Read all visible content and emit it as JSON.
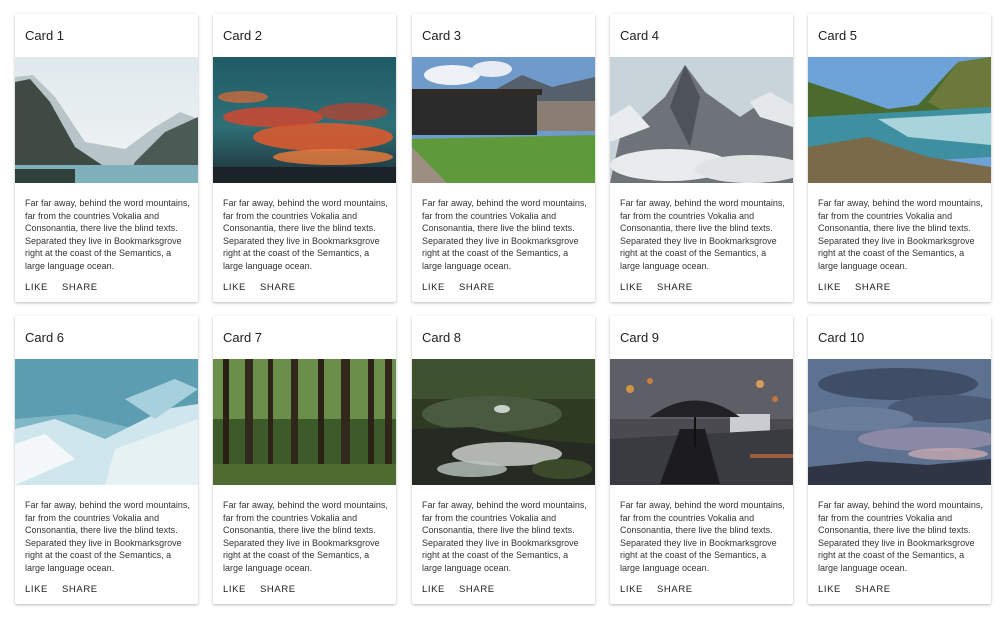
{
  "cards": [
    {
      "title": "Card 1",
      "image": "mountain-lake",
      "text": "Far far away, behind the word mountains, far from the countries Vokalia and Consonantia, there live the blind texts. Separated they live in Bookmarksgrove right at the coast of the Semantics, a large language ocean.",
      "like_label": "LIKE",
      "share_label": "SHARE"
    },
    {
      "title": "Card 2",
      "image": "sunset-clouds",
      "text": "Far far away, behind the word mountains, far from the countries Vokalia and Consonantia, there live the blind texts. Separated they live in Bookmarksgrove right at the coast of the Semantics, a large language ocean.",
      "like_label": "LIKE",
      "share_label": "SHARE"
    },
    {
      "title": "Card 3",
      "image": "modern-house",
      "text": "Far far away, behind the word mountains, far from the countries Vokalia and Consonantia, there live the blind texts. Separated they live in Bookmarksgrove right at the coast of the Semantics, a large language ocean.",
      "like_label": "LIKE",
      "share_label": "SHARE"
    },
    {
      "title": "Card 4",
      "image": "snowy-peak",
      "text": "Far far away, behind the word mountains, far from the countries Vokalia and Consonantia, there live the blind texts. Separated they live in Bookmarksgrove right at the coast of the Semantics, a large language ocean.",
      "like_label": "LIKE",
      "share_label": "SHARE"
    },
    {
      "title": "Card 5",
      "image": "mountain-river",
      "text": "Far far away, behind the word mountains, far from the countries Vokalia and Consonantia, there live the blind texts. Separated they live in Bookmarksgrove right at the coast of the Semantics, a large language ocean.",
      "like_label": "LIKE",
      "share_label": "SHARE"
    },
    {
      "title": "Card 6",
      "image": "ice-cave",
      "text": "Far far away, behind the word mountains, far from the countries Vokalia and Consonantia, there live the blind texts. Separated they live in Bookmarksgrove right at the coast of the Semantics, a large language ocean.",
      "like_label": "LIKE",
      "share_label": "SHARE"
    },
    {
      "title": "Card 7",
      "image": "forest",
      "text": "Far far away, behind the word mountains, far from the countries Vokalia and Consonantia, there live the blind texts. Separated they live in Bookmarksgrove right at the coast of the Semantics, a large language ocean.",
      "like_label": "LIKE",
      "share_label": "SHARE"
    },
    {
      "title": "Card 8",
      "image": "forest-stream",
      "text": "Far far away, behind the word mountains, far from the countries Vokalia and Consonantia, there live the blind texts. Separated they live in Bookmarksgrove right at the coast of the Semantics, a large language ocean.",
      "like_label": "LIKE",
      "share_label": "SHARE"
    },
    {
      "title": "Card 9",
      "image": "rainy-street-umbrella",
      "text": "Far far away, behind the word mountains, far from the countries Vokalia and Consonantia, there live the blind texts. Separated they live in Bookmarksgrove right at the coast of the Semantics, a large language ocean.",
      "like_label": "LIKE",
      "share_label": "SHARE"
    },
    {
      "title": "Card 10",
      "image": "cloudy-sky",
      "text": "Far far away, behind the word mountains, far from the countries Vokalia and Consonantia, there live the blind texts. Separated they live in Bookmarksgrove right at the coast of the Semantics, a large language ocean.",
      "like_label": "LIKE",
      "share_label": "SHARE"
    }
  ]
}
